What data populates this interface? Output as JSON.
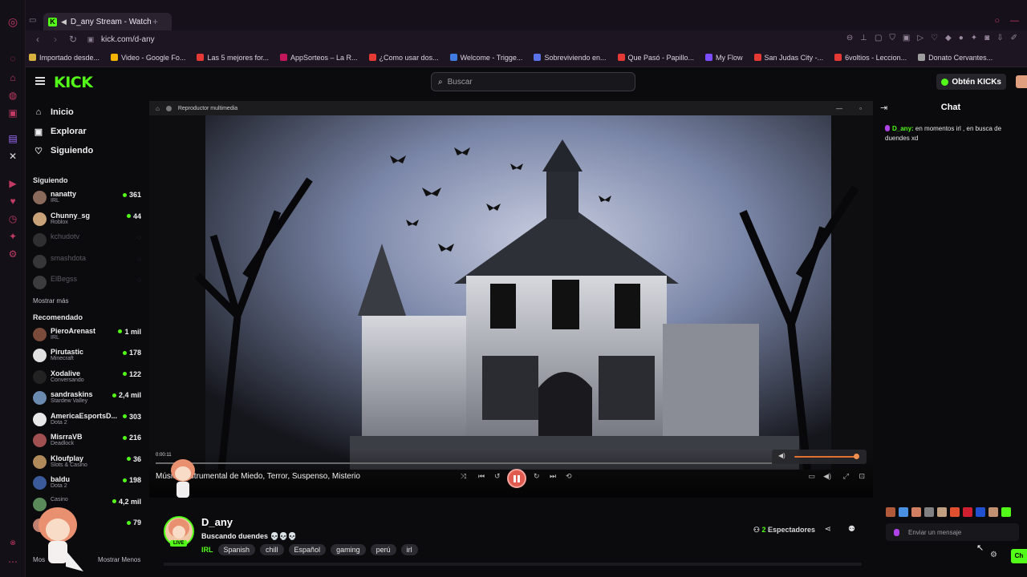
{
  "browser": {
    "tab_title": "D_any Stream - Watch",
    "url": "kick.com/d-any",
    "bookmarks": [
      {
        "label": "Importado desde...",
        "color": "#d8b040"
      },
      {
        "label": "Video - Google Fo...",
        "color": "#f4b400"
      },
      {
        "label": "Las 5 mejores for...",
        "color": "#e53935"
      },
      {
        "label": "AppSorteos – La R...",
        "color": "#c2185b"
      },
      {
        "label": "¿Como usar dos...",
        "color": "#e53935"
      },
      {
        "label": "Welcome - Trigge...",
        "color": "#3f7be0"
      },
      {
        "label": "Sobreviviendo en...",
        "color": "#5b73e8"
      },
      {
        "label": "Que Pasó - Papillo...",
        "color": "#e53935"
      },
      {
        "label": "My Flow",
        "color": "#7c4dff"
      },
      {
        "label": "San Judas City -...",
        "color": "#e53935"
      },
      {
        "label": "6voltios - Leccion...",
        "color": "#e53935"
      },
      {
        "label": "Donato Cervantes...",
        "color": "#9e9e9e"
      }
    ]
  },
  "header": {
    "logo": "KICK",
    "search_placeholder": "Buscar",
    "kicks_label": "Obtén KICKs"
  },
  "sidebar": {
    "nav": [
      {
        "label": "Inicio",
        "icon": "home-icon"
      },
      {
        "label": "Explorar",
        "icon": "compass-icon"
      },
      {
        "label": "Siguiendo",
        "icon": "heart-icon"
      }
    ],
    "following_title": "Siguiendo",
    "following": [
      {
        "name": "nanatty",
        "category": "IRL",
        "viewers": "361",
        "avatar": "#8a6a5a"
      },
      {
        "name": "Chunny_sg",
        "category": "Roblox",
        "viewers": "44",
        "avatar": "#c9a27a"
      },
      {
        "name": "kchudotv",
        "category": "",
        "viewers": "",
        "avatar": "#666"
      },
      {
        "name": "smashdota",
        "category": "",
        "viewers": "",
        "avatar": "#777"
      },
      {
        "name": "ElBegss",
        "category": "",
        "viewers": "",
        "avatar": "#888"
      }
    ],
    "show_more": "Mostrar más",
    "recommended_title": "Recomendado",
    "recommended": [
      {
        "name": "PieroArenast",
        "category": "IRL",
        "viewers": "1 mil",
        "avatar": "#7a4a3a"
      },
      {
        "name": "Pirutastic",
        "category": "Minecraft",
        "viewers": "178",
        "avatar": "#e0e0e0"
      },
      {
        "name": "Xodalive",
        "category": "Conversando",
        "viewers": "122",
        "avatar": "#222"
      },
      {
        "name": "sandraskins",
        "category": "Stardew Valley",
        "viewers": "2,4 mil",
        "avatar": "#6a8ab0"
      },
      {
        "name": "AmericaEsportsD...",
        "category": "Dota 2",
        "viewers": "303",
        "avatar": "#e8e8e8"
      },
      {
        "name": "MisrraVB",
        "category": "Deadlock",
        "viewers": "216",
        "avatar": "#a05050"
      },
      {
        "name": "Kloufplay",
        "category": "Slots & Casino",
        "viewers": "36",
        "avatar": "#b08a5a"
      },
      {
        "name": "baldu",
        "category": "Dota 2",
        "viewers": "198",
        "avatar": "#3a5a9a"
      },
      {
        "name": "",
        "category": "Casino",
        "viewers": "4,2 mil",
        "avatar": "#5a8a5a"
      },
      {
        "name": "ntO",
        "category": "nversando",
        "viewers": "79",
        "avatar": "#c08070"
      }
    ],
    "show_less": "Mostrar Menos"
  },
  "player": {
    "window_title": "Reproductor multimedia",
    "elapsed": "0:00:11",
    "track_title": "Música Instrumental de Miedo, Terror, Suspenso, Misterio",
    "volume": 0.95,
    "progress": 0.0
  },
  "stream": {
    "streamer": "D_any",
    "live_badge": "LIVE",
    "title": "Buscando duendes 💀💀💀",
    "language": "IRL",
    "tags": [
      "Spanish",
      "chill",
      "Español",
      "gaming",
      "perú",
      "irl"
    ],
    "viewers_count": "2",
    "viewers_label": "Espectadores"
  },
  "chat": {
    "title": "Chat",
    "messages": [
      {
        "user": "D_any",
        "text": " en momentos irl , en busca de duendes xd"
      }
    ],
    "input_placeholder": "Enviar un mensaje",
    "send_label": "Ch",
    "emote_colors": [
      "#b05a3a",
      "#4a90e2",
      "#d08060",
      "#808080",
      "#c0a080",
      "#e05030",
      "#d02030",
      "#2050d0",
      "#c09070",
      "#53fc18"
    ]
  }
}
